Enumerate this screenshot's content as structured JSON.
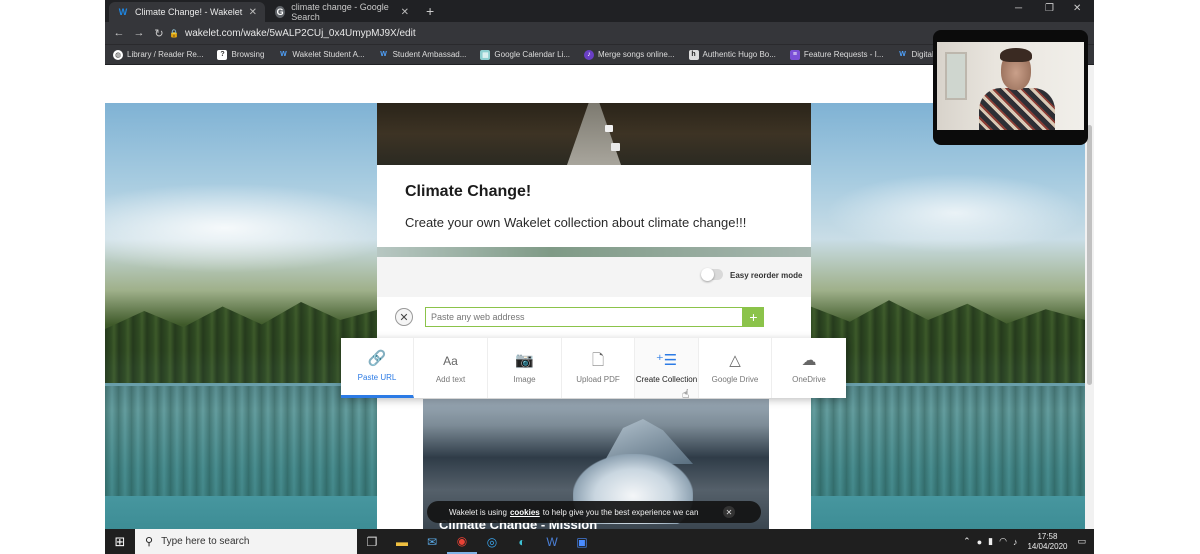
{
  "browser": {
    "tabs": [
      {
        "label": "Climate Change! - Wakelet",
        "favicon": "W",
        "active": true
      },
      {
        "label": "climate change - Google Search",
        "favicon": "G",
        "active": false
      }
    ],
    "url": "wakelet.com/wake/5wALP2CUj_0x4UmypMJ9X/edit",
    "bookmarks": [
      {
        "label": "Library / Reader Re...",
        "icon": "globe-icon"
      },
      {
        "label": "Browsing",
        "icon": "question-icon"
      },
      {
        "label": "Wakelet Student A...",
        "icon": "W"
      },
      {
        "label": "Student Ambassad...",
        "icon": "W"
      },
      {
        "label": "Google Calendar Li...",
        "icon": "calendar-icon"
      },
      {
        "label": "Merge songs online...",
        "icon": "audio-icon"
      },
      {
        "label": "Authentic Hugo Bo...",
        "icon": "h"
      },
      {
        "label": "Feature Requests - I...",
        "icon": "list-icon"
      },
      {
        "label": "Digital Tools - W",
        "icon": "W"
      }
    ]
  },
  "collection": {
    "title": "Climate Change!",
    "description": "Create your own Wakelet collection about climate change!!!",
    "reorder_label": "Easy reorder mode",
    "url_placeholder": "Paste any web address",
    "add_symbol": "+",
    "close_symbol": "✕",
    "caption_peek": "Climate Change - Mission"
  },
  "add_menu": {
    "items": [
      {
        "label": "Paste URL",
        "icon": "link-icon",
        "state": "active"
      },
      {
        "label": "Add text",
        "icon": "text-icon",
        "glyph": "Aa",
        "state": "normal"
      },
      {
        "label": "Image",
        "icon": "camera-icon",
        "state": "normal"
      },
      {
        "label": "Upload PDF",
        "icon": "document-icon",
        "state": "normal"
      },
      {
        "label": "Create Collection",
        "icon": "add-list-icon",
        "state": "hover"
      },
      {
        "label": "Google Drive",
        "icon": "google-drive-icon",
        "state": "normal"
      },
      {
        "label": "OneDrive",
        "icon": "cloud-icon",
        "state": "normal"
      }
    ]
  },
  "cookie_bar": {
    "text_before": "Wakelet is using",
    "link": "cookies",
    "text_after": "to help give you the best experience we can",
    "close_symbol": "✕"
  },
  "taskbar": {
    "search_placeholder": "Type here to search",
    "time": "17:58",
    "date": "14/04/2020"
  },
  "colors": {
    "accent_blue": "#2c7be5",
    "accent_green": "#8bc34a",
    "wakelet_blue": "#1e88e5"
  }
}
